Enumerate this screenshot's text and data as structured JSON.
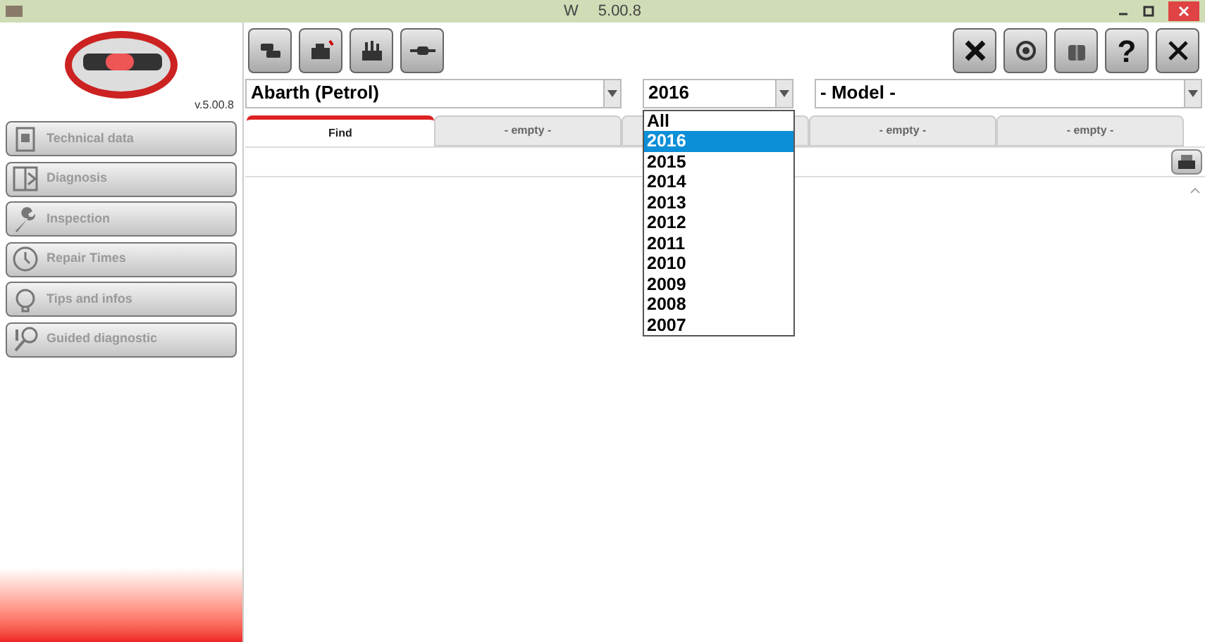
{
  "window": {
    "title_start": "W",
    "title_end": "5.00.8"
  },
  "logo": {
    "version": "v.5.00.8"
  },
  "sidebar": {
    "items": [
      {
        "label": "Technical data"
      },
      {
        "label": "Diagnosis"
      },
      {
        "label": "Inspection"
      },
      {
        "label": "Repair Times"
      },
      {
        "label": "Tips and infos"
      },
      {
        "label": "Guided diagnostic"
      }
    ]
  },
  "help_button": {
    "text": "?"
  },
  "make_select": {
    "value": "Abarth (Petrol)"
  },
  "year_select": {
    "value": "2016",
    "expanded": true,
    "options": [
      {
        "label": "All",
        "selected": false
      },
      {
        "label": "2016",
        "selected": true
      },
      {
        "label": "2015",
        "selected": false
      },
      {
        "label": "2014",
        "selected": false
      },
      {
        "label": "2013",
        "selected": false
      },
      {
        "label": "2012",
        "selected": false
      },
      {
        "label": "2011",
        "selected": false
      },
      {
        "label": "2010",
        "selected": false
      },
      {
        "label": "2009",
        "selected": false
      },
      {
        "label": "2008",
        "selected": false
      },
      {
        "label": "2007",
        "selected": false
      }
    ]
  },
  "model_select": {
    "value": "- Model -"
  },
  "tabs": [
    {
      "label": "Find",
      "selected": true
    },
    {
      "label": "- empty -",
      "selected": false
    },
    {
      "selected": false
    },
    {
      "label": "- empty -",
      "selected": false
    },
    {
      "label": "- empty -",
      "selected": false
    }
  ]
}
